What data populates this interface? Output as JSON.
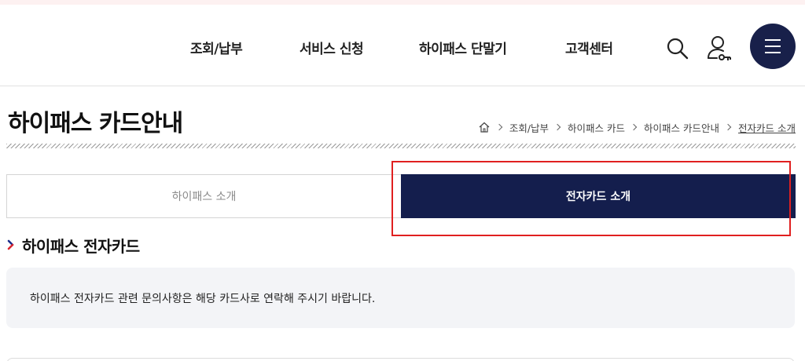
{
  "header": {
    "nav": [
      "조회/납부",
      "서비스 신청",
      "하이패스 단말기",
      "고객센터"
    ],
    "icons": {
      "search": "search-icon",
      "user": "user-icon",
      "menu": "hamburger-menu-icon"
    },
    "menu_button_color": "#18204a"
  },
  "page": {
    "title": "하이패스 카드안내"
  },
  "breadcrumb": {
    "home_icon": "home-icon",
    "items": [
      "조회/납부",
      "하이패스 카드",
      "하이패스 카드안내",
      "전자카드 소개"
    ]
  },
  "tabs": [
    {
      "label": "하이패스 소개",
      "active": false
    },
    {
      "label": "전자카드 소개",
      "active": true
    }
  ],
  "section": {
    "title": "하이패스 전자카드",
    "info": "하이패스 전자카드 관련 문의사항은 해당 카드사로 연락해 주시기 바랍니다."
  },
  "colors": {
    "accent_navy": "#141e4d",
    "highlight_red": "#e02020",
    "bullet_blue": "#1b2e8c",
    "bullet_red": "#d8262f"
  }
}
